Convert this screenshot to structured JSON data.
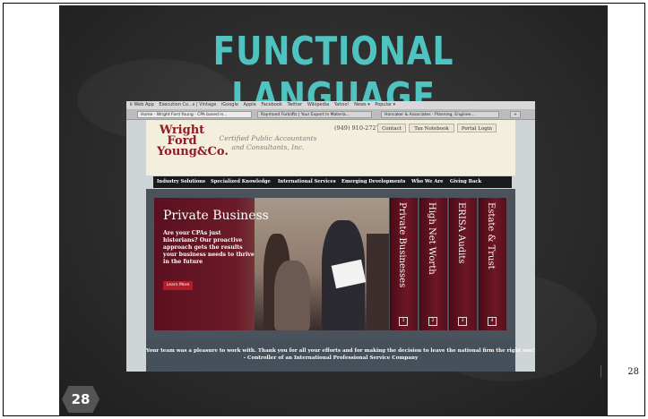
{
  "slide": {
    "title": "FUNCTIONAL LANGUAGE",
    "slide_number": "28",
    "page_number": "28"
  },
  "browser": {
    "bookmarks": [
      "k Web App",
      "Execution Co...s | Vintage",
      "iGoogle",
      "Apple",
      "Facebook",
      "Twitter",
      "Wikipedia",
      "Yahoo!",
      "News ▾",
      "Popular ▾"
    ],
    "tabs": [
      "Home - Wright Ford Young - CPA based in...",
      "Raymond Forklifts | Your Expert in Materia...",
      "Honcaker & Associates - Planning, Enginee..."
    ],
    "new_tab_label": "+"
  },
  "site": {
    "logo": [
      "Wright",
      "Ford",
      "Young&Co."
    ],
    "tagline_1": "Certified Public Accountants",
    "tagline_2": "and Consultants, Inc.",
    "phone": "(949) 910-2727",
    "header_buttons": [
      "Contact",
      "Tax Notebook",
      "Portal Login"
    ],
    "nav": [
      "Industry Solutions",
      "Specialized Knowledge",
      "International Services",
      "Emerging Developments",
      "Who We Are",
      "Giving Back"
    ],
    "hero": {
      "heading": "Private Business",
      "text": "Are your CPAs just historians? Our proactive approach gets the results your business needs to thrive in the future",
      "button": "Learn More"
    },
    "vertical_tabs": [
      {
        "label": "Private Businesses",
        "num": "1"
      },
      {
        "label": "High Net Worth",
        "num": "2"
      },
      {
        "label": "ERISA Audits",
        "num": "3"
      },
      {
        "label": "Estate & Trust",
        "num": "4"
      }
    ],
    "quote_line_1": "Your team was a pleasure to work with. Thank you for all your efforts and for making the decision to leave the national firm the right one!",
    "quote_line_2": "- Controller of an International Professional Service Company"
  },
  "colors": {
    "title_teal": "#4fc3c0",
    "brand_red": "#8c1d24",
    "chalkboard": "#2c2c2c"
  }
}
